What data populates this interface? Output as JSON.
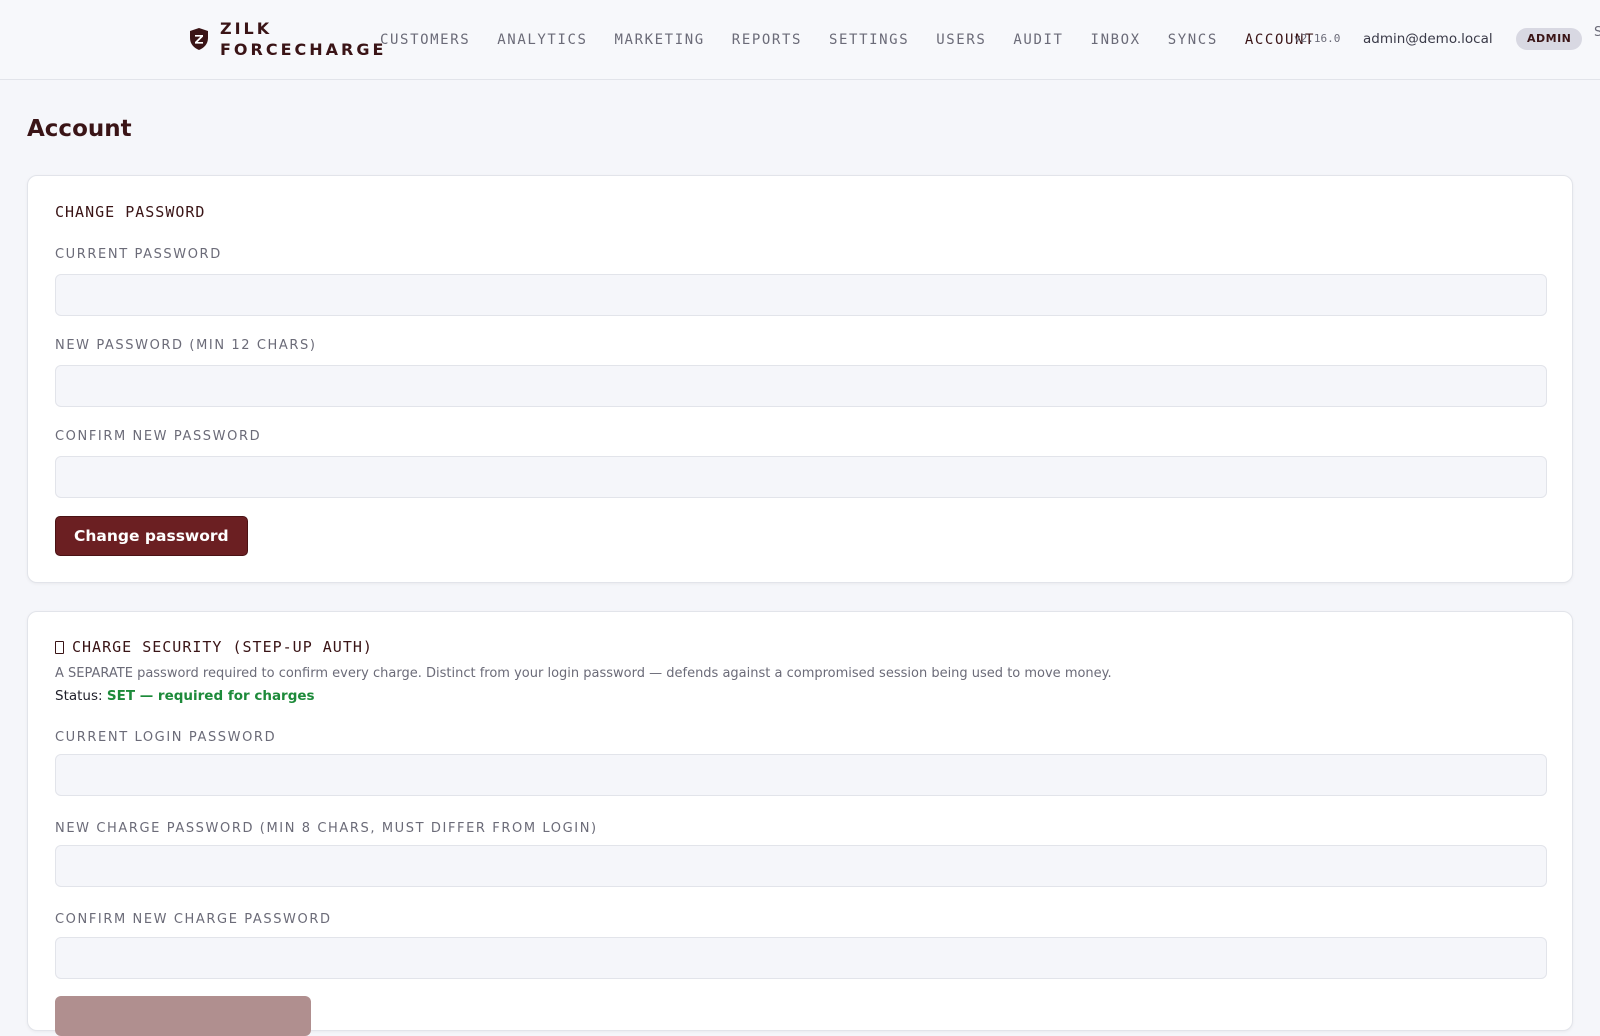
{
  "brand": {
    "line1": "ZILK",
    "line2": "FORCECHARGE",
    "icon": "shield-z-icon"
  },
  "nav": {
    "items": [
      {
        "label": "CUSTOMERS"
      },
      {
        "label": "ANALYTICS"
      },
      {
        "label": "MARKETING"
      },
      {
        "label": "REPORTS"
      },
      {
        "label": "SETTINGS"
      },
      {
        "label": "USERS"
      },
      {
        "label": "AUDIT"
      },
      {
        "label": "INBOX"
      },
      {
        "label": "SYNCS"
      },
      {
        "label": "ACCOUNT",
        "active": true
      }
    ]
  },
  "header": {
    "version": "v2.16.0",
    "user_email": "admin@demo.local",
    "role_badge": "ADMIN",
    "signout_clip": "S"
  },
  "page": {
    "title": "Account"
  },
  "change_password": {
    "title": "CHANGE PASSWORD",
    "current_label": "CURRENT PASSWORD",
    "current_value": "",
    "new_label": "NEW PASSWORD (MIN 12 CHARS)",
    "new_value": "",
    "confirm_label": "CONFIRM NEW PASSWORD",
    "confirm_value": "",
    "button_label": "Change password"
  },
  "charge_security": {
    "icon": "lock-icon",
    "title": "CHARGE SECURITY (STEP-UP AUTH)",
    "description": "A SEPARATE password required to confirm every charge. Distinct from your login password — defends against a compromised session being used to move money.",
    "status_label": "Status:",
    "status_value": "SET — required for charges",
    "login_label": "CURRENT LOGIN PASSWORD",
    "login_value": "",
    "new_label": "NEW CHARGE PASSWORD (MIN 8 CHARS, MUST DIFFER FROM LOGIN)",
    "new_value": "",
    "confirm_label": "CONFIRM NEW CHARGE PASSWORD",
    "confirm_value": ""
  },
  "colors": {
    "brand_dark": "#3a1416",
    "primary_button": "#6b1f22",
    "status_ok": "#1d8a3a",
    "secondary_button": "#b08f8f"
  }
}
